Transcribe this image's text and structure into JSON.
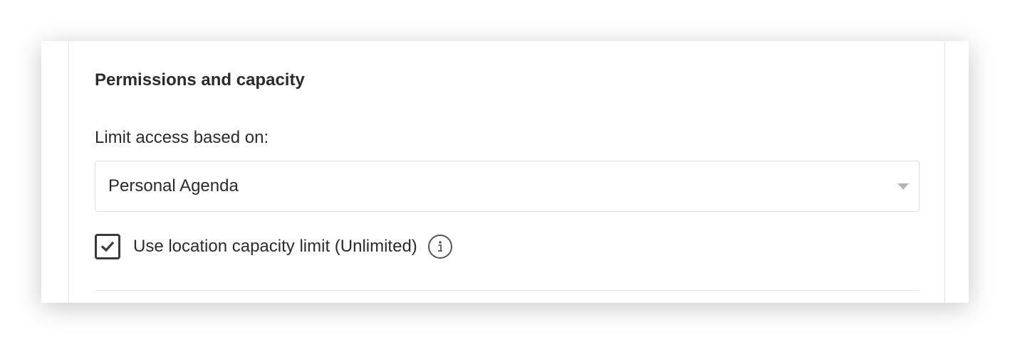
{
  "section": {
    "title": "Permissions and capacity"
  },
  "access": {
    "label": "Limit access based on:",
    "selected": "Personal Agenda"
  },
  "capacity": {
    "checked": true,
    "label": "Use location capacity limit (Unlimited)"
  },
  "icons": {
    "checkbox": "check-icon",
    "caret": "chevron-down-icon",
    "info": "info-icon"
  },
  "colors": {
    "text": "#2b2b2b",
    "border": "#dedede",
    "checkbox_border": "#3a3a3a",
    "caret": "#b5b5b5"
  }
}
